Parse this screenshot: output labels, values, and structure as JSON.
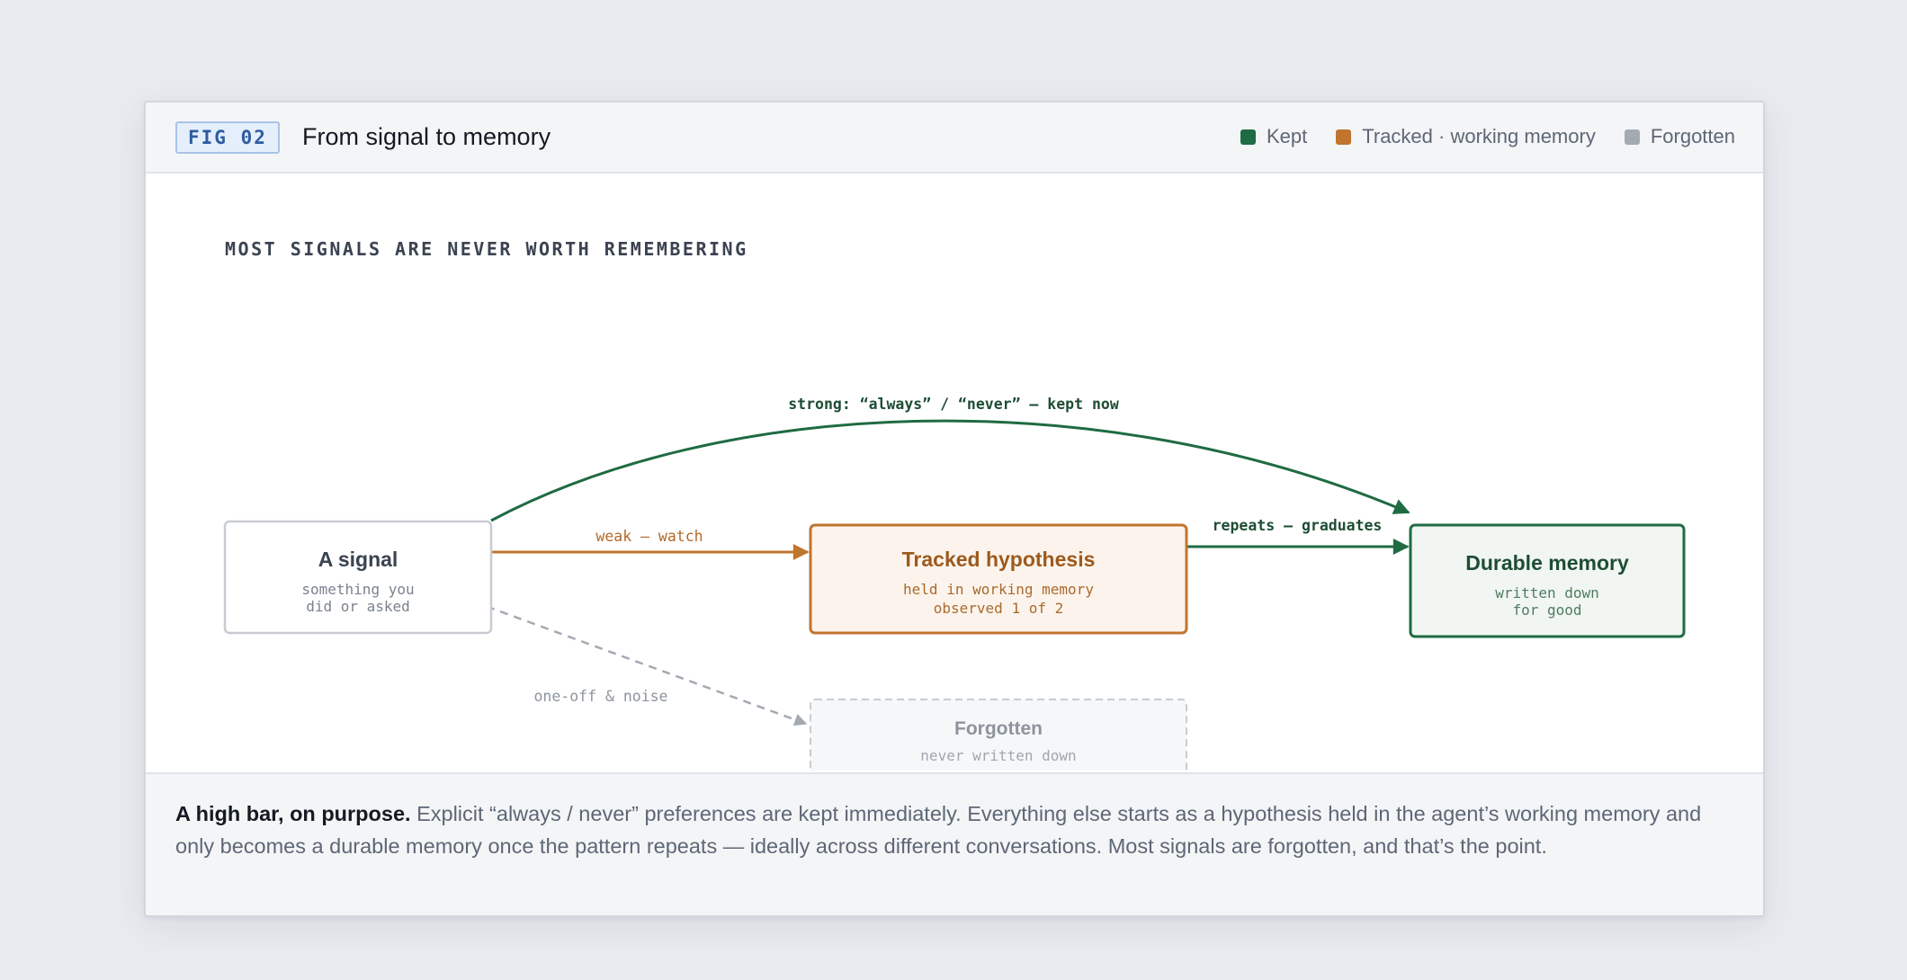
{
  "figure": {
    "badge": "FIG 02",
    "title": "From signal to memory"
  },
  "legend": [
    {
      "label": "Kept",
      "color": "#1f6b43"
    },
    {
      "label": "Tracked · working memory",
      "color": "#c0742e"
    },
    {
      "label": "Forgotten",
      "color": "#a4aab2"
    }
  ],
  "diagram": {
    "heading": "MOST SIGNALS ARE NEVER WORTH REMEMBERING",
    "nodes": {
      "signal": {
        "title": "A signal",
        "sub1": "something you",
        "sub2": "did or asked"
      },
      "tracked": {
        "title": "Tracked hypothesis",
        "sub1": "held in working memory",
        "sub2": "observed 1 of 2"
      },
      "durable": {
        "title": "Durable memory",
        "sub1": "written down",
        "sub2": "for good"
      },
      "forgotten": {
        "title": "Forgotten",
        "sub1": "never written down"
      }
    },
    "edges": {
      "strong": "strong: “always” / “never” — kept now",
      "weak": "weak — watch",
      "repeats": "repeats — graduates",
      "noise": "one-off & noise"
    }
  },
  "caption": {
    "lead": "A high bar, on purpose.",
    "body": " Explicit “always / never” preferences are kept immediately. Everything else starts as a hypothesis held in the agent’s working memory and only becomes a durable memory once the pattern repeats — ideally across different conversations. Most signals are forgotten, and that’s the point."
  }
}
